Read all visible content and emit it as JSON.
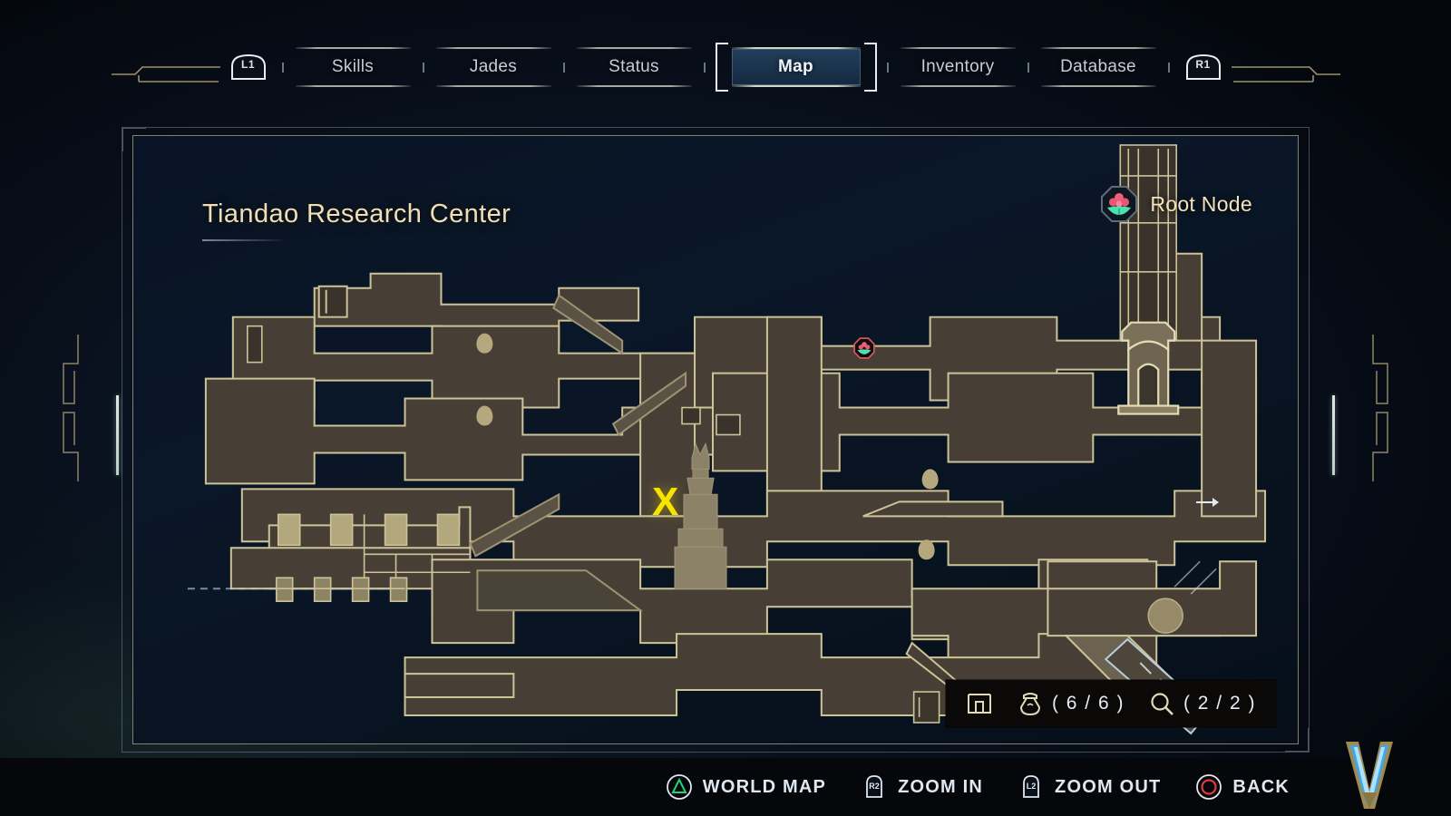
{
  "nav": {
    "left_bumper": "L1",
    "right_bumper": "R1",
    "tabs": [
      {
        "label": "Skills",
        "active": false
      },
      {
        "label": "Jades",
        "active": false
      },
      {
        "label": "Status",
        "active": false
      },
      {
        "label": "Map",
        "active": true
      },
      {
        "label": "Inventory",
        "active": false
      },
      {
        "label": "Database",
        "active": false
      }
    ]
  },
  "map": {
    "title": "Tiandao Research Center",
    "root_node_label": "Root Node",
    "root_node_icon": "root-node-flower-icon",
    "player_marker": "X",
    "markers": {
      "root_node_on_map": "root-node-map-icon",
      "exit_arrow": "exit-arrow-icon"
    }
  },
  "counters": {
    "rooms_icon": "room-layout-icon",
    "treasure_icon": "treasure-bag-icon",
    "treasure_count": "( 6 / 6 )",
    "secrets_icon": "magnifier-icon",
    "secrets_count": "( 2 / 2 )"
  },
  "actions": [
    {
      "button": "triangle",
      "label": "WORLD MAP"
    },
    {
      "button": "R2",
      "label": "ZOOM IN"
    },
    {
      "button": "L2",
      "label": "ZOOM OUT"
    },
    {
      "button": "circle",
      "label": "BACK"
    }
  ],
  "colors": {
    "accent_gold": "#f2deb4",
    "map_room_fill": "#473f35",
    "map_room_stroke": "#cdc398",
    "map_bg": "#0a1728",
    "player_marker": "#f7e400",
    "tab_active_fill": "#244260",
    "triangle_green": "#1fd479",
    "circle_red": "#e03a3a"
  }
}
